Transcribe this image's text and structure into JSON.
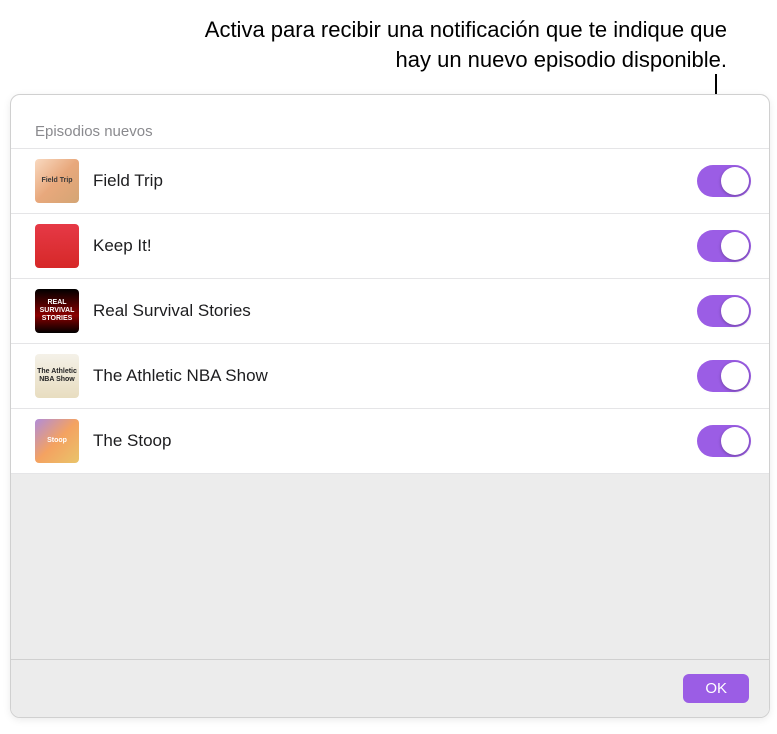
{
  "callout": "Activa para recibir una notificación que te indique que hay un nuevo episodio disponible.",
  "section_header": "Episodios nuevos",
  "podcasts": [
    {
      "title": "Field Trip",
      "enabled": true,
      "art_label": "Field Trip"
    },
    {
      "title": "Keep It!",
      "enabled": true,
      "art_label": ""
    },
    {
      "title": "Real Survival Stories",
      "enabled": true,
      "art_label": "REAL SURVIVAL STORIES"
    },
    {
      "title": "The Athletic NBA Show",
      "enabled": true,
      "art_label": "The Athletic NBA Show"
    },
    {
      "title": "The Stoop",
      "enabled": true,
      "art_label": "Stoop"
    }
  ],
  "footer": {
    "ok_label": "OK"
  },
  "colors": {
    "accent": "#9b5de5"
  }
}
